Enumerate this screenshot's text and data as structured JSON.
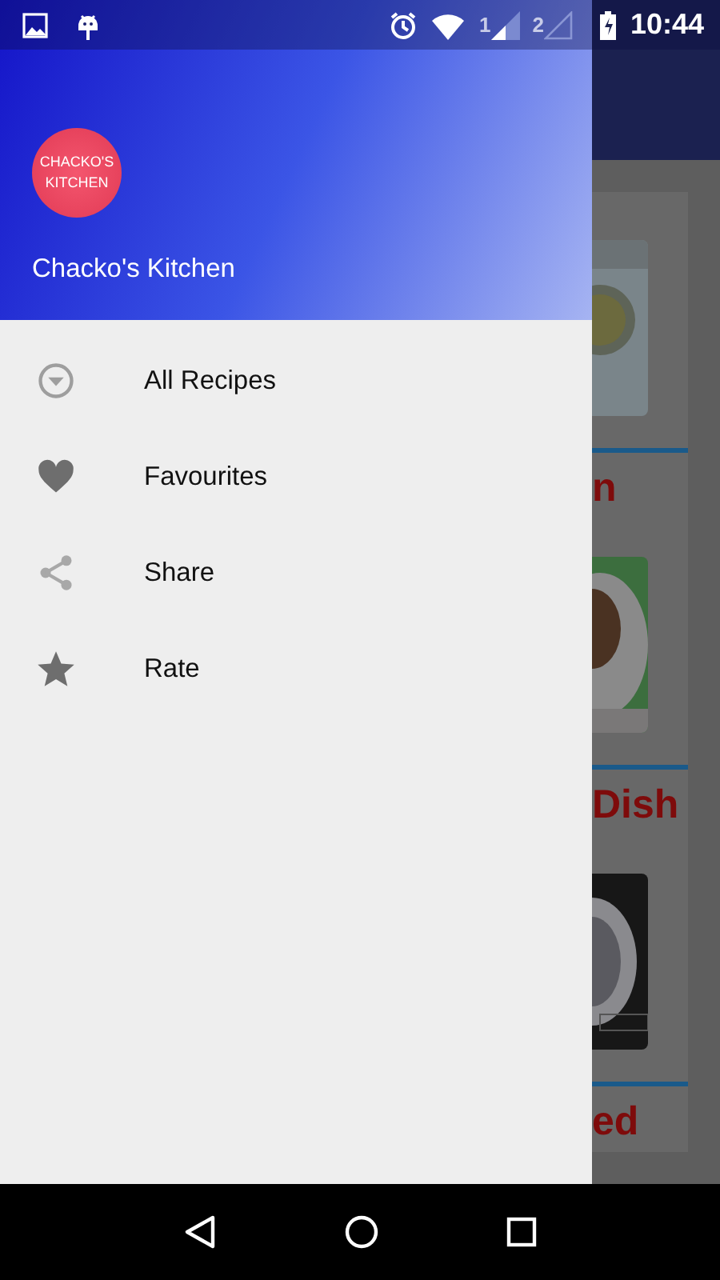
{
  "status_bar": {
    "sim_slots": [
      "1",
      "2"
    ],
    "time": "10:44"
  },
  "drawer": {
    "logo_lines": [
      "CHACKO'S",
      "KITCHEN"
    ],
    "title": "Chacko's Kitchen",
    "items": [
      {
        "kind": "arrow",
        "label": "All Recipes"
      },
      {
        "kind": "heart",
        "label": "Favourites"
      },
      {
        "kind": "share",
        "label": "Share"
      },
      {
        "kind": "star",
        "label": "Rate"
      }
    ]
  },
  "behind_list": [
    {
      "kind": "picture"
    },
    {
      "kind": "title",
      "text": "n"
    },
    {
      "kind": "picture"
    },
    {
      "kind": "title",
      "text": "Dish"
    },
    {
      "kind": "picture"
    },
    {
      "kind": "title",
      "text": "ed"
    }
  ]
}
